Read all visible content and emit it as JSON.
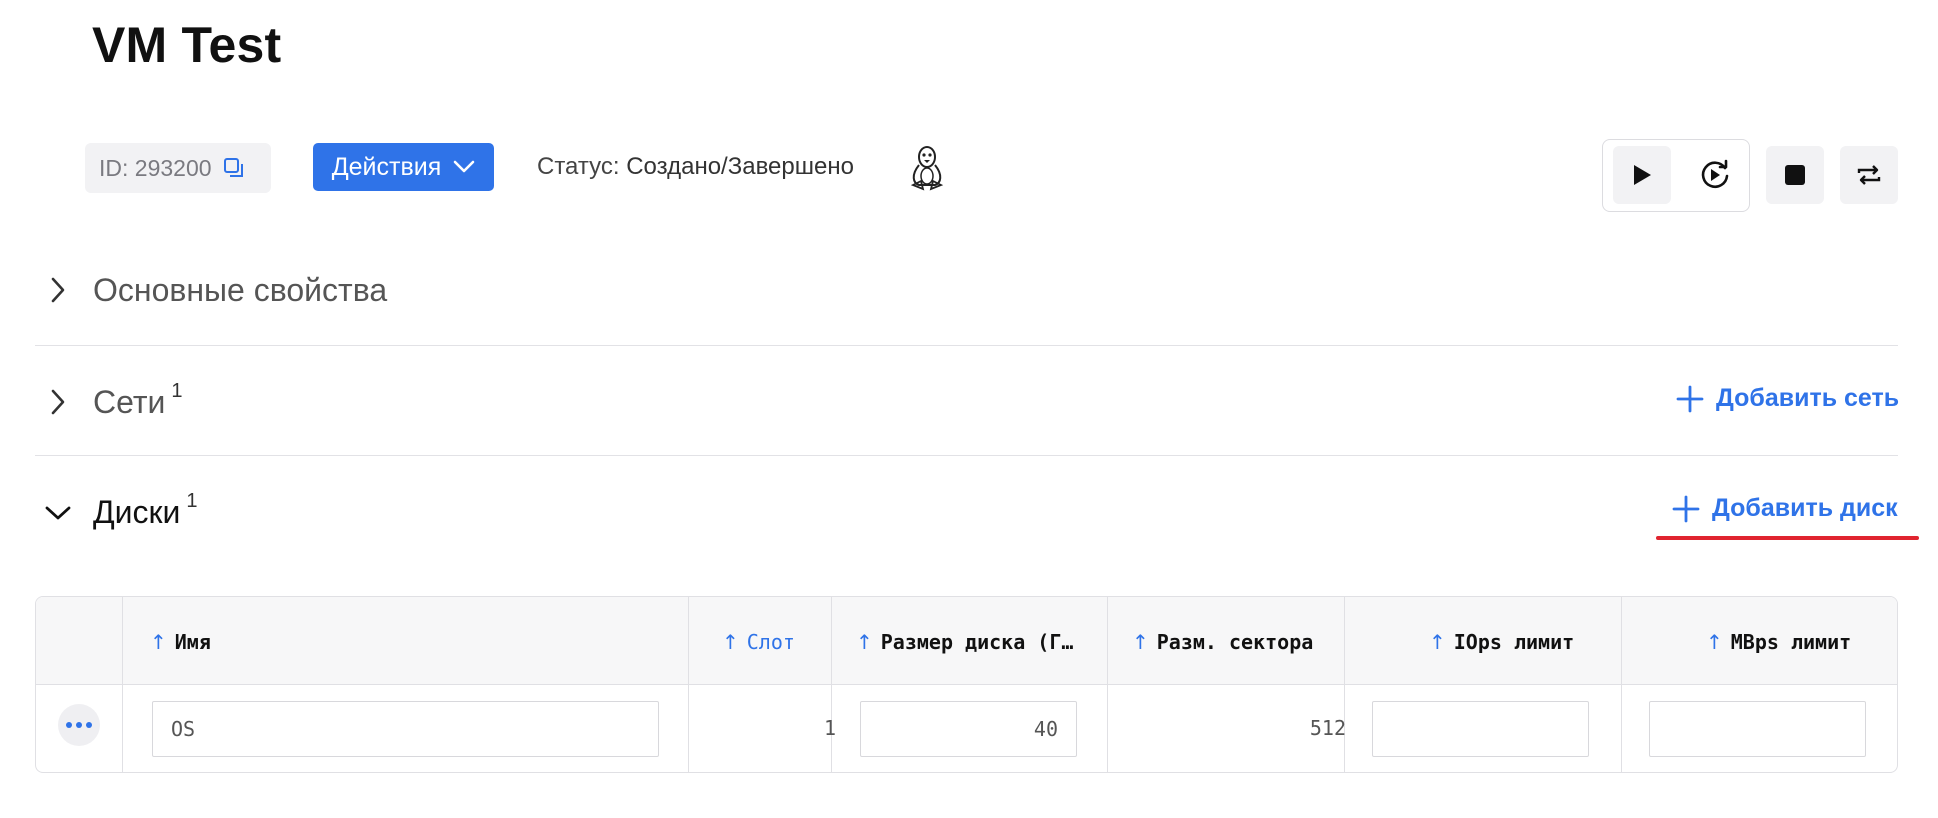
{
  "page": {
    "title": "VM Test"
  },
  "header": {
    "id_label": "ID: 293200",
    "actions_label": "Действия",
    "status_label": "Статус:",
    "status_value": "Создано/Завершено",
    "os_icon": "linux-tux-icon"
  },
  "controls": [
    {
      "icon": "play-icon"
    },
    {
      "icon": "restart-icon"
    },
    {
      "icon": "stop-icon"
    },
    {
      "icon": "migrate-icon"
    }
  ],
  "sections": {
    "basic": {
      "label": "Основные свойства",
      "expanded": false
    },
    "networks": {
      "label": "Сети",
      "count": "1",
      "expanded": false,
      "add_label": "Добавить сеть"
    },
    "disks": {
      "label": "Диски",
      "count": "1",
      "expanded": true,
      "add_label": "Добавить диск"
    }
  },
  "disks_table": {
    "columns": [
      {
        "label": "Имя",
        "sort": "asc",
        "active": false
      },
      {
        "label": "Слот",
        "sort": "asc",
        "active": true
      },
      {
        "label": "Размер диска (Г…",
        "sort": "asc",
        "active": false
      },
      {
        "label": "Разм. сектора",
        "sort": "asc",
        "active": false
      },
      {
        "label": "IOps лимит",
        "sort": "asc",
        "active": false
      },
      {
        "label": "MBps лимит",
        "sort": "asc",
        "active": false
      }
    ],
    "rows": [
      {
        "name": "OS",
        "slot": "1",
        "size": "40",
        "sector": "512",
        "iops": "",
        "mbps": ""
      }
    ]
  },
  "colors": {
    "accent": "#2f73e8",
    "highlight_underline": "#e0242f"
  }
}
